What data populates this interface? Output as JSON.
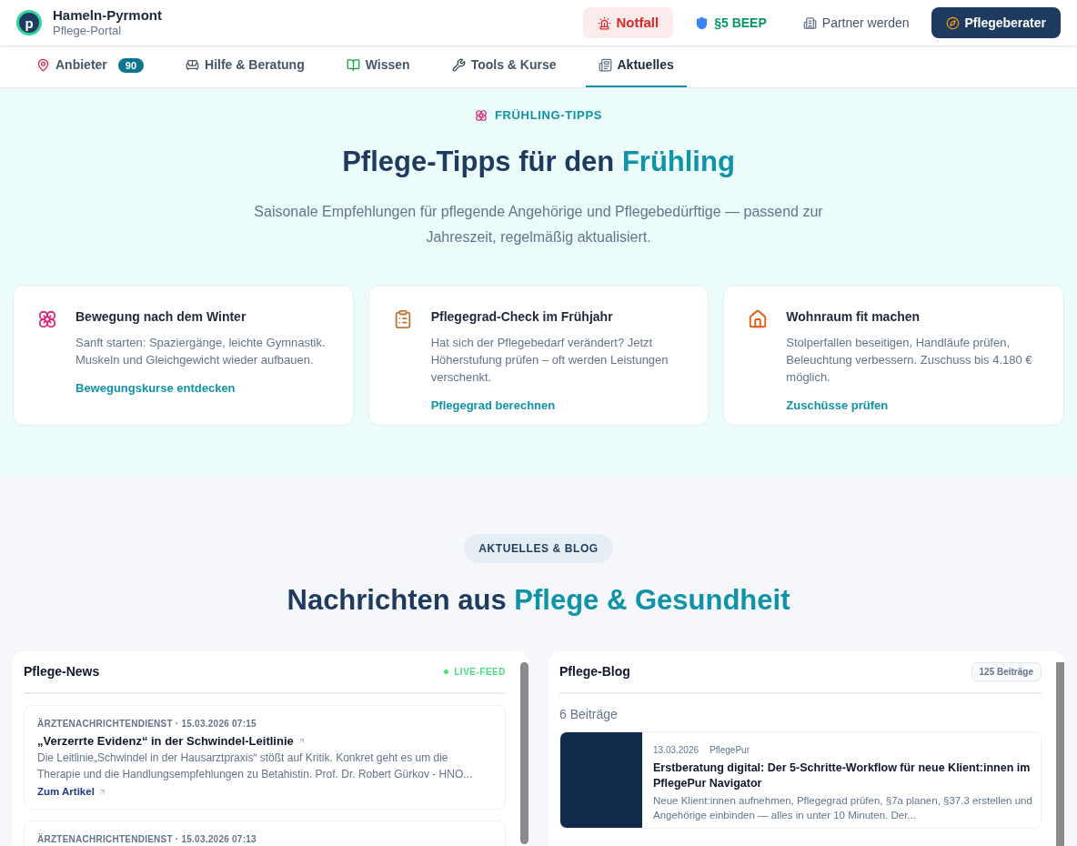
{
  "brand": {
    "logo_letter": "p",
    "name": "Hameln-Pyrmont",
    "subtitle": "Pflege-Portal"
  },
  "header_actions": [
    {
      "kind": "sos",
      "label": "Notfall"
    },
    {
      "kind": "shield",
      "label": "§5 BEEP"
    },
    {
      "kind": "building",
      "label": "Partner werden"
    },
    {
      "kind": "primary",
      "label": "Pflegeberater"
    }
  ],
  "tabs": [
    {
      "kind": "pin",
      "label": "Anbieter",
      "badge": "90",
      "selected": false
    },
    {
      "kind": "sofa",
      "label": "Hilfe & Beratung",
      "selected": false
    },
    {
      "kind": "book",
      "label": "Wissen",
      "selected": false
    },
    {
      "kind": "tools",
      "label": "Tools & Kurse",
      "selected": false
    },
    {
      "kind": "news",
      "label": "Aktuelles",
      "selected": true
    }
  ],
  "hero": {
    "eyebrow": "FRÜHLING-TIPPS",
    "title": "Pflege-Tipps für den",
    "title_accent": "Frühling",
    "description": "Saisonale Empfehlungen für pflegende Angehörige und Pflegebedürftige — passend zur Jahreszeit, regelmäßig aktualisiert."
  },
  "tips": [
    {
      "kind": "tulip",
      "title": "Bewegung nach dem Winter",
      "text": "Sanft starten: Spaziergänge, leichte Gymnastik. Muskeln und Gleichgewicht wieder aufbauen.",
      "link": "Bewegungskurse entdecken"
    },
    {
      "kind": "clipboard",
      "title": "Pflegegrad-Check im Frühjahr",
      "text": "Hat sich der Pflegebedarf verändert? Jetzt Höherstufung prüfen – oft werden Leistungen verschenkt.",
      "link": "Pflegegrad berechnen"
    },
    {
      "kind": "house",
      "title": "Wohnraum fit machen",
      "text": "Stolperfallen beseitigen, Handläufe prüfen, Beleuchtung verbessern. Zuschuss bis 4.180 € möglich.",
      "link": "Zuschüsse prüfen"
    }
  ],
  "news_section": {
    "pill": "AKTUELLES & BLOG",
    "title": "Nachrichten aus",
    "title_accent": "Pflege & Gesundheit"
  },
  "news_panel": {
    "title": "Pflege-News",
    "live_label": "LIVE-FEED",
    "items": [
      {
        "meta": "ÄRZTENACHRICHTENDIENST · 15.03.2026 07:15",
        "title": "„Verzerrte Evidenz“ in der Schwindel-Leitlinie",
        "excerpt": "Die Leitlinie„Schwindel in der Hausarztpraxis“ stößt auf Kritik. Konkret geht es um die Therapie und die Handlungsempfehlungen zu Betahistin. Prof. Dr. Robert Gürkov - HNO...",
        "link": "Zum Artikel"
      },
      {
        "meta": "ÄRZTENACHRICHTENDIENST · 15.03.2026 07:13"
      }
    ]
  },
  "blog_panel": {
    "title": "Pflege-Blog",
    "total": "125 Beiträge",
    "count": "6 Beiträge",
    "posts": [
      {
        "date": "13.03.2026",
        "author": "PflegePur",
        "title": "Erstberatung digital: Der 5-Schritte-Workflow für neue Klient:innen im PflegePur Navigator",
        "excerpt": "Neue Klient:innen aufnehmen, Pflegegrad prüfen, §7a planen, §37.3 erstellen und Angehörige einbinden — alles in unter 10 Minuten. Der..."
      }
    ]
  }
}
